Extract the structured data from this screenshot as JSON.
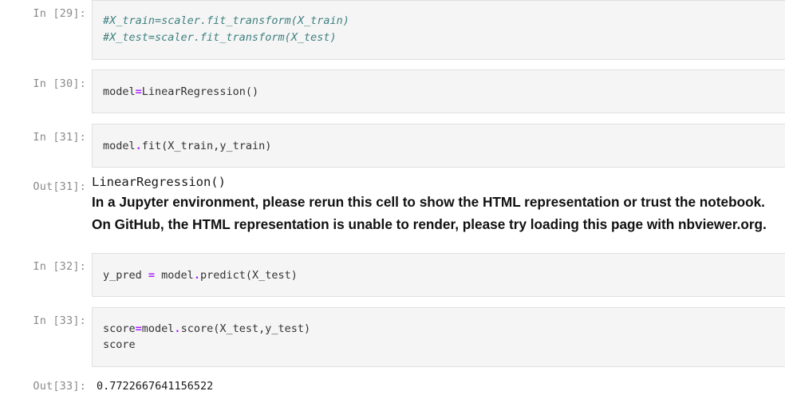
{
  "cells": {
    "c29": {
      "prompt": "In [29]:",
      "line1": "#X_train=scaler.fit_transform(X_train)",
      "line2": "#X_test=scaler.fit_transform(X_test)"
    },
    "c30": {
      "prompt": "In [30]:",
      "lhs": "model",
      "op": "=",
      "rhs": "LinearRegression()"
    },
    "c31": {
      "prompt": "In [31]:",
      "obj": "model",
      "dot": ".",
      "call": "fit(X_train,y_train)"
    },
    "out31": {
      "prompt": "Out[31]:",
      "repr": "LinearRegression()",
      "warning1": "In a Jupyter environment, please rerun this cell to show the HTML representation or trust the notebook.",
      "warning2": "On GitHub, the HTML representation is unable to render, please try loading this page with nbviewer.org."
    },
    "c32": {
      "prompt": "In [32]:",
      "lhs": "y_pred ",
      "op": "=",
      "obj": " model",
      "dot": ".",
      "call": "predict(X_test)"
    },
    "c33": {
      "prompt": "In [33]:",
      "lhs": "score",
      "op": "=",
      "obj": "model",
      "dot": ".",
      "call": "score(X_test,y_test)",
      "line2": "score"
    },
    "out33": {
      "prompt": "Out[33]:",
      "value": "0.7722667641156522"
    }
  },
  "colors": {
    "comment": "#408080",
    "operator": "#aa22ff",
    "prompt": "#8a8a8a",
    "cell_bg": "#f5f5f5"
  }
}
